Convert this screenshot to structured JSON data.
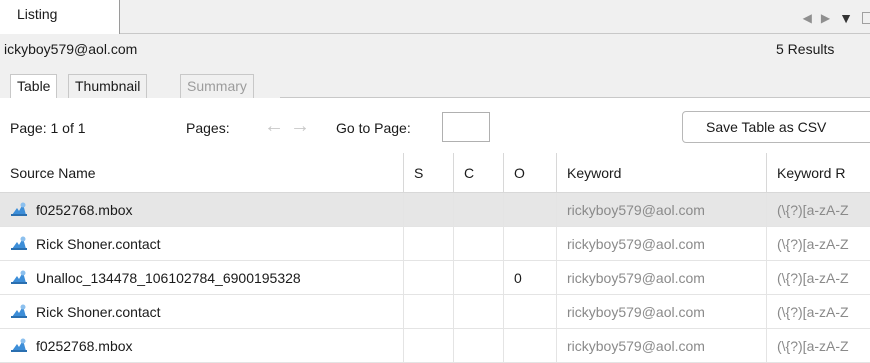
{
  "tabs": {
    "listing_label": "Listing"
  },
  "info": {
    "query": "ickyboy579@aol.com",
    "results": "5 Results"
  },
  "subtabs": [
    {
      "label": "Table",
      "state": "active"
    },
    {
      "label": "Thumbnail",
      "state": "normal"
    },
    {
      "label": "Summary",
      "state": "disabled"
    }
  ],
  "toolbar": {
    "page_label": "Page: 1 of 1",
    "pages_label": "Pages:",
    "prev_icon": "←",
    "next_icon": "→",
    "goto_label": "Go to Page:",
    "goto_value": "",
    "save_csv_label": "Save Table as CSV"
  },
  "table": {
    "columns": [
      "Source Name",
      "S",
      "C",
      "O",
      "Keyword",
      "Keyword R"
    ],
    "rows": [
      {
        "source": "f0252768.mbox",
        "s": "",
        "c": "",
        "o": "",
        "keyword": "rickyboy579@aol.com",
        "regex": "(\\{?)[a-zA-Z"
      },
      {
        "source": "Rick Shoner.contact",
        "s": "",
        "c": "",
        "o": "",
        "keyword": "rickyboy579@aol.com",
        "regex": "(\\{?)[a-zA-Z"
      },
      {
        "source": "Unalloc_134478_106102784_6900195328",
        "s": "",
        "c": "",
        "o": "0",
        "keyword": "rickyboy579@aol.com",
        "regex": "(\\{?)[a-zA-Z"
      },
      {
        "source": "Rick Shoner.contact",
        "s": "",
        "c": "",
        "o": "",
        "keyword": "rickyboy579@aol.com",
        "regex": "(\\{?)[a-zA-Z"
      },
      {
        "source": "f0252768.mbox",
        "s": "",
        "c": "",
        "o": "",
        "keyword": "rickyboy579@aol.com",
        "regex": "(\\{?)[a-zA-Z"
      }
    ]
  },
  "colors": {
    "selected_row": "#e6e6e6",
    "icon_blue": "#3d8ed8",
    "muted_text": "#8a8a8a"
  }
}
